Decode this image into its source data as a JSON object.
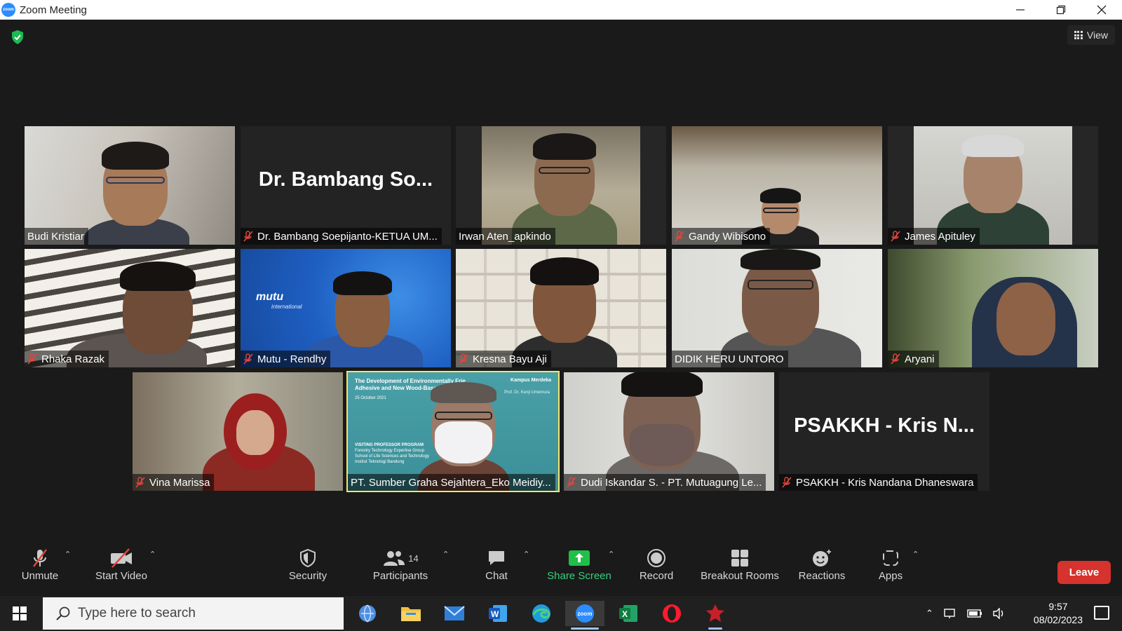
{
  "window": {
    "title": "Zoom Meeting",
    "logo_text": "zoom"
  },
  "meeting": {
    "view_label": "View"
  },
  "participants": [
    {
      "name": "Budi Kristiar",
      "muted": false,
      "video": true
    },
    {
      "name": "Dr. Bambang Soepijanto-KETUA UM...",
      "display": "Dr. Bambang So...",
      "muted": true,
      "video": false
    },
    {
      "name": "Irwan Aten_apkindo",
      "muted": false,
      "video": true
    },
    {
      "name": "Gandy Wibisono",
      "muted": true,
      "video": true
    },
    {
      "name": "James Apituley",
      "muted": true,
      "video": true
    },
    {
      "name": "Rhaka Razak",
      "muted": true,
      "video": true
    },
    {
      "name": "Mutu - Rendhy",
      "muted": true,
      "video": true
    },
    {
      "name": "Kresna Bayu Aji",
      "muted": true,
      "video": true
    },
    {
      "name": "DIDIK HERU UNTORO",
      "muted": false,
      "video": true
    },
    {
      "name": "Aryani",
      "muted": true,
      "video": true
    },
    {
      "name": "Vina Marissa",
      "muted": true,
      "video": true
    },
    {
      "name": "PT. Sumber Graha Sejahtera_Eko Meidiy...",
      "muted": false,
      "video": true,
      "active_speaker": true
    },
    {
      "name": "Dudi Iskandar S. - PT. Mutuagung Le...",
      "muted": true,
      "video": true
    },
    {
      "name": "PSAKKH - Kris Nandana Dhaneswara",
      "display": "PSAKKH - Kris N...",
      "muted": true,
      "video": false
    }
  ],
  "slide": {
    "title_line1": "The Development of Environmentally Frie",
    "title_line2": "Adhesive and New Wood-Based Mat",
    "date": "25 October 2021",
    "author": "Prof. Dr. Kenji Umemura",
    "program": "VISITING PROFESSOR PROGRAM",
    "sub1": "Forestry Technology Expertise Group",
    "sub2": "School of Life Sciences and Technology",
    "sub3": "Institut Teknologi Bandung",
    "logo": "Kampus Merdeka"
  },
  "mutu_logo": "mutu",
  "mutu_sub": "international",
  "toolbar": {
    "unmute": "Unmute",
    "start_video": "Start Video",
    "security": "Security",
    "participants": "Participants",
    "participants_count": "14",
    "chat": "Chat",
    "share_screen": "Share Screen",
    "record": "Record",
    "breakout_rooms": "Breakout Rooms",
    "reactions": "Reactions",
    "apps": "Apps",
    "leave": "Leave"
  },
  "taskbar": {
    "search_placeholder": "Type here to search",
    "time": "9:57",
    "date": "08/02/2023",
    "zoom_label": "zoom"
  },
  "colors": {
    "accent_green": "#33d17a",
    "leave_red": "#d6322e",
    "active_speaker": "#f5e66a",
    "zoom_blue": "#2D8CFF"
  }
}
